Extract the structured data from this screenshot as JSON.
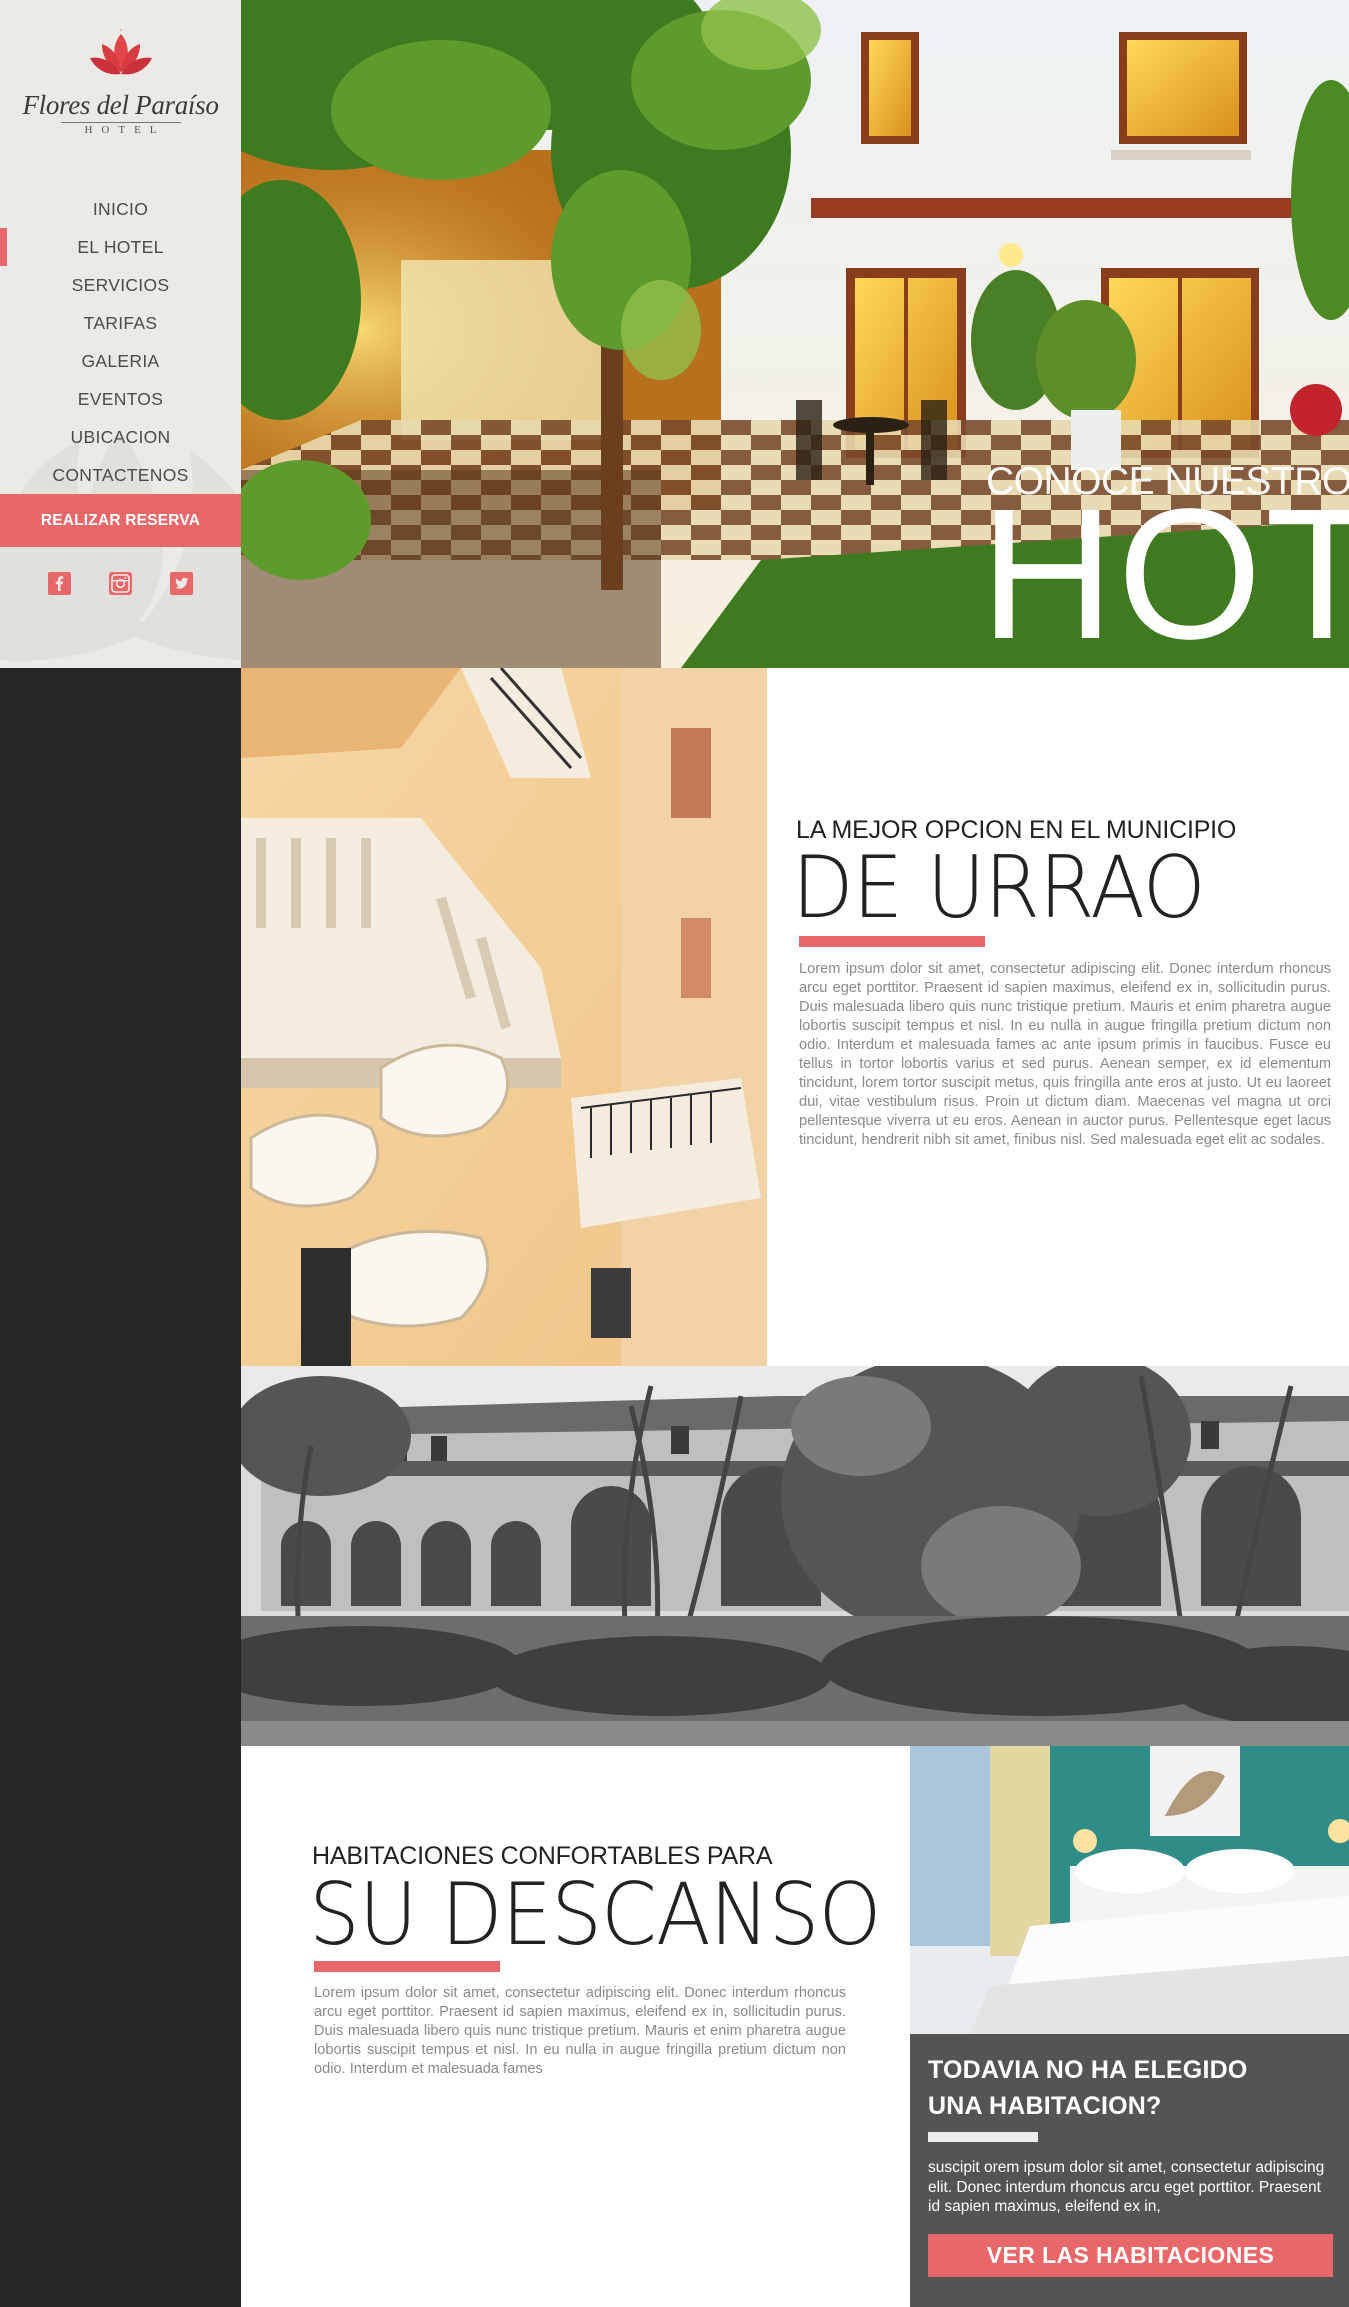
{
  "brand": {
    "name": "Flores del Paraíso",
    "subtitle": "HOTEL"
  },
  "nav": {
    "items": [
      "INICIO",
      "EL HOTEL",
      "SERVICIOS",
      "TARIFAS",
      "GALERIA",
      "EVENTOS",
      "UBICACION",
      "CONTACTENOS"
    ],
    "active": "EL HOTEL"
  },
  "reserve_button": "REALIZAR RESERVA",
  "social": [
    "facebook-icon",
    "instagram-icon",
    "twitter-icon"
  ],
  "hero": {
    "kicker": "CONOCE NUESTRO",
    "title": "HOTEL"
  },
  "section_municipio": {
    "kicker": "LA MEJOR OPCION EN EL MUNICIPIO",
    "headline": "DE URRAO",
    "body": "Lorem ipsum dolor sit amet, consectetur adipiscing elit. Donec interdum rhoncus arcu eget porttitor. Praesent id sapien maximus, eleifend ex in, sollicitudin purus. Duis malesuada libero quis nunc tristique pretium. Mauris et enim pharetra augue lobortis suscipit tempus et nisl. In eu nulla in augue fringilla pretium dictum non odio. Interdum et malesuada fames ac ante ipsum primis in faucibus. Fusce eu tellus in tortor lobortis varius et sed purus. Aenean semper, ex id elementum tincidunt, lorem tortor suscipit metus, quis fringilla ante eros at justo. Ut eu laoreet dui, vitae vestibulum risus. Proin ut dictum diam. Maecenas vel magna ut orci pellentesque viverra ut eu eros. Aenean in auctor purus. Pellentesque eget lacus tincidunt, hendrerit nibh sit amet, finibus nisl. Sed malesuada eget elit ac sodales."
  },
  "section_descanso": {
    "kicker": "HABITACIONES CONFORTABLES PARA",
    "headline": "SU DESCANSO",
    "body": "Lorem ipsum dolor sit amet, consectetur adipiscing elit. Donec interdum rhoncus arcu eget porttitor. Praesent id sapien maximus, eleifend ex in, sollicitudin purus. Duis malesuada libero quis nunc tristique pretium. Mauris et enim pharetra augue lobortis suscipit tempus et nisl. In eu nulla in augue fringilla pretium dictum non odio. Interdum et malesuada fames"
  },
  "cta": {
    "title_line1": "TODAVIA NO HA ELEGIDO",
    "title_line2": "UNA HABITACION?",
    "text": "suscipit orem ipsum dolor sit amet, consectetur adipiscing elit. Donec interdum rhoncus arcu eget porttitor. Praesent id sapien maximus, eleifend ex in,",
    "button": "VER LAS HABITACIONES"
  },
  "colors": {
    "accent": "#e8686a",
    "sidebar": "#eceae7",
    "dark": "#262626",
    "cta_bg": "#545454"
  }
}
